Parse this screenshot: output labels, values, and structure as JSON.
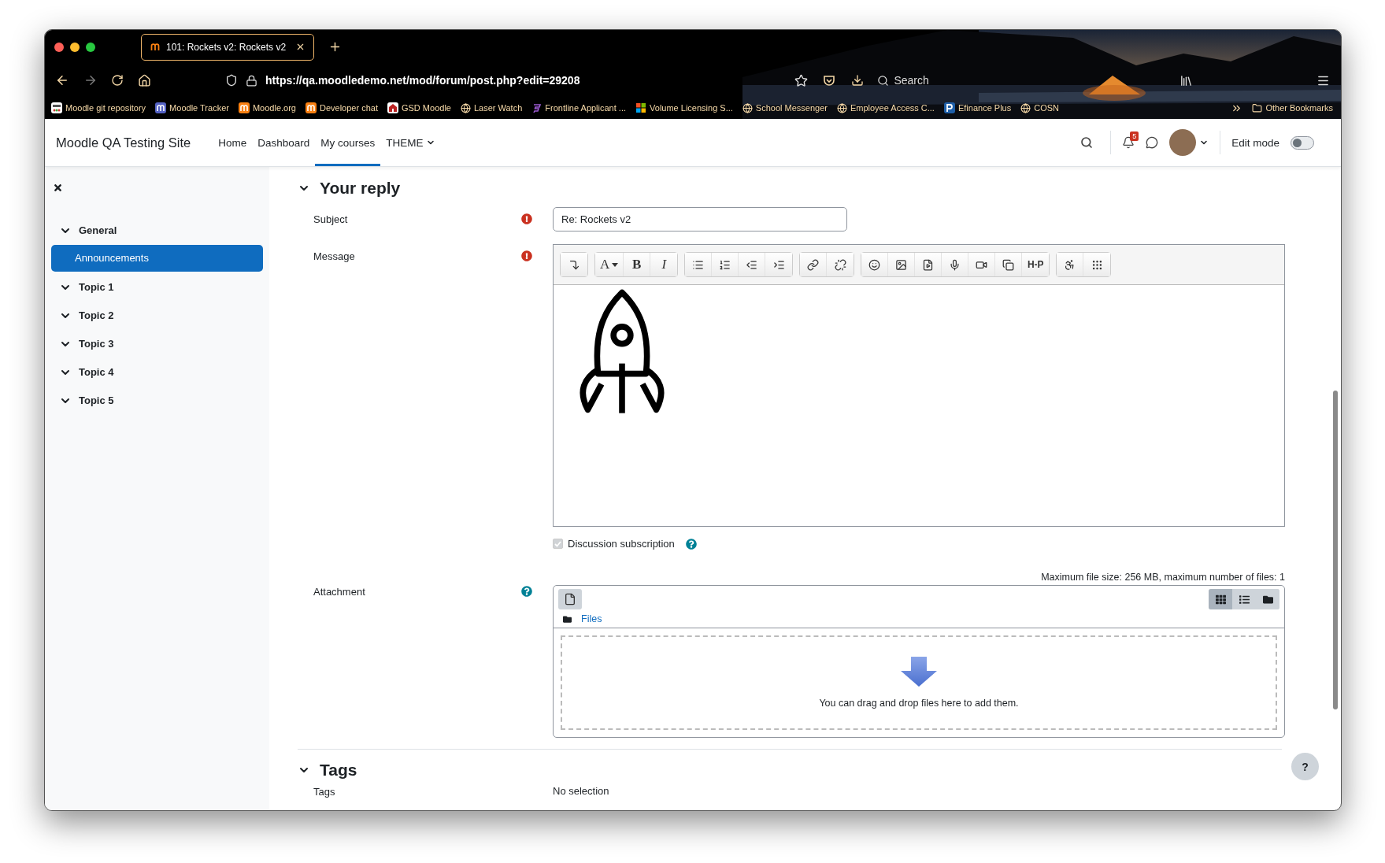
{
  "browser": {
    "tab": {
      "title": "101: Rockets v2: Rockets v2",
      "selected": true
    },
    "url": "https://qa.moodledemo.net/mod/forum/post.php?edit=29208",
    "search_placeholder": "Search",
    "bookmarks": [
      {
        "label": "Moodle git repository",
        "kind": "dots"
      },
      {
        "label": "Moodle Tracker",
        "kind": "tracker"
      },
      {
        "label": "Moodle.org",
        "kind": "moodle"
      },
      {
        "label": "Developer chat",
        "kind": "moodle"
      },
      {
        "label": "GSD Moodle",
        "kind": "school"
      },
      {
        "label": "Laser Watch",
        "kind": "globe"
      },
      {
        "label": "Frontline Applicant ...",
        "kind": "form"
      },
      {
        "label": "Volume Licensing S...",
        "kind": "windows"
      },
      {
        "label": "School Messenger",
        "kind": "globe"
      },
      {
        "label": "Employee Access C...",
        "kind": "globe"
      },
      {
        "label": "Efinance Plus",
        "kind": "letter"
      },
      {
        "label": "COSN",
        "kind": "globe"
      }
    ],
    "other_bookmarks": "Other Bookmarks"
  },
  "navbar": {
    "site_name": "Moodle QA Testing Site",
    "links": [
      {
        "label": "Home",
        "selected": false,
        "kind": "link"
      },
      {
        "label": "Dashboard",
        "selected": false,
        "kind": "link"
      },
      {
        "label": "My courses",
        "selected": true,
        "kind": "link"
      },
      {
        "label": "THEME",
        "selected": false,
        "kind": "dropdown"
      }
    ],
    "notification_count": "5",
    "edit_mode": {
      "label": "Edit mode",
      "on": false
    }
  },
  "drawer": {
    "sections": [
      {
        "label": "General",
        "expanded": true,
        "children": [
          {
            "label": "Announcements",
            "selected": true
          }
        ]
      },
      {
        "label": "Topic 1",
        "expanded": true
      },
      {
        "label": "Topic 2",
        "expanded": true
      },
      {
        "label": "Topic 3",
        "expanded": true
      },
      {
        "label": "Topic 4",
        "expanded": true
      },
      {
        "label": "Topic 5",
        "expanded": true
      }
    ]
  },
  "form": {
    "section_title": "Your reply",
    "expanded": true,
    "subject": {
      "label": "Subject",
      "required": true,
      "value": "Re: Rockets v2"
    },
    "message": {
      "label": "Message",
      "required": true,
      "toolbar": [
        [
          {
            "kind": "icon"
          }
        ],
        [
          {
            "kind": "menu",
            "label": "A"
          },
          {
            "kind": "text",
            "label": "B"
          },
          {
            "kind": "text",
            "label": "I"
          }
        ],
        [
          {
            "kind": "icon"
          },
          {
            "kind": "icon"
          },
          {
            "kind": "icon"
          },
          {
            "kind": "icon"
          }
        ],
        [
          {
            "kind": "icon"
          },
          {
            "kind": "icon"
          }
        ],
        [
          {
            "kind": "icon"
          },
          {
            "kind": "icon"
          },
          {
            "kind": "icon"
          },
          {
            "kind": "icon"
          },
          {
            "kind": "icon"
          },
          {
            "kind": "icon"
          },
          {
            "kind": "text",
            "label": "H-P"
          }
        ],
        [
          {
            "kind": "icon"
          },
          {
            "kind": "icon"
          }
        ]
      ]
    },
    "subscription": {
      "label": "Discussion subscription",
      "checked": true,
      "disabled": true
    },
    "attachment": {
      "label": "Attachment",
      "limits": "Maximum file size: 256 MB, maximum number of files: 1",
      "path": "Files",
      "views": [
        {
          "selected": true
        },
        {
          "selected": false
        },
        {
          "selected": false
        }
      ],
      "drop_hint": "You can drag and drop files here to add them."
    }
  },
  "tags": {
    "section_title": "Tags",
    "expanded": true,
    "label": "Tags",
    "value": "No selection"
  },
  "help_button": "?"
}
